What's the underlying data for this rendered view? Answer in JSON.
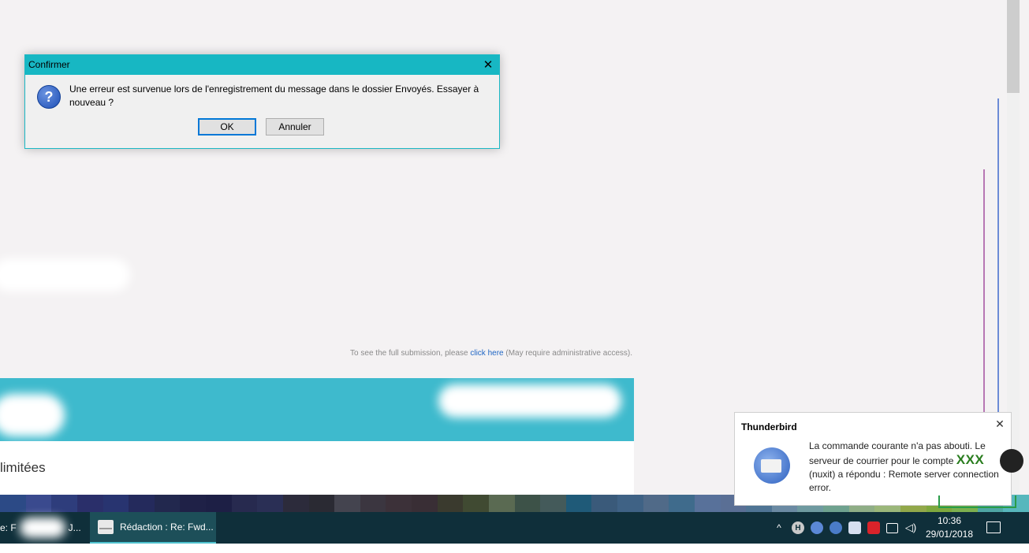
{
  "background": {
    "submission_prefix": "To see the full submission, please ",
    "submission_link": "click here",
    "submission_suffix": " (May require administrative access).",
    "section_text": "limitées"
  },
  "dialog": {
    "title": "Confirmer",
    "message": "Une erreur est survenue lors de l'enregistrement du message dans le dossier Envoyés. Essayer à nouveau ?",
    "ok_label": "OK",
    "cancel_label": "Annuler",
    "icon": "question-icon"
  },
  "toast": {
    "title": "Thunderbird",
    "message_part1": "La commande courante n'a pas abouti. Le serveur de courrier pour le compte ",
    "account": "XXX",
    "message_part2": " (nuxit) a répondu : Remote server connection error.",
    "icon": "thunderbird-icon"
  },
  "taskbar": {
    "item1_label": "e: F",
    "item1_suffix": "J...",
    "item2_label": "Rédaction : Re: Fwd...",
    "clock_time": "10:36",
    "clock_date": "29/01/2018",
    "tray_icons": [
      "chevron-up-icon",
      "h-icon",
      "thunderbird-tray-icon",
      "thunderbird-tray-icon-2",
      "lock-icon",
      "avira-icon",
      "network-icon",
      "volume-icon"
    ]
  },
  "colors": {
    "dialog_title_bar": "#17b7c3",
    "banner": "#3ebacd",
    "taskbar": "#0f2f3a",
    "accent_link": "#1f66c4"
  }
}
